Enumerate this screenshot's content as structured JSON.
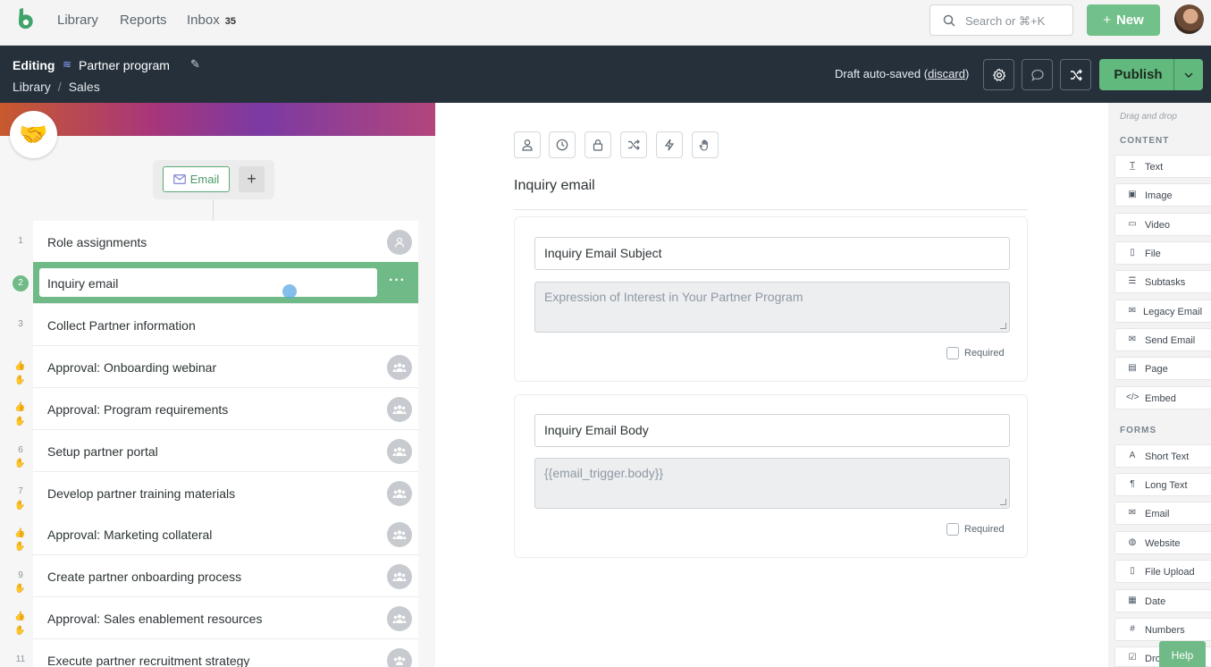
{
  "nav": {
    "links": [
      "Library",
      "Reports",
      "Inbox"
    ],
    "inbox_count": "35",
    "search_placeholder": "Search or ⌘+K",
    "new_label": "New"
  },
  "editbar": {
    "mode": "Editing",
    "title": "Partner program",
    "breadcrumb": [
      "Library",
      "Sales"
    ],
    "draft_text": "Draft auto-saved",
    "discard_label": "discard",
    "publish_label": "Publish"
  },
  "trigger": {
    "label": "Email"
  },
  "tasks": [
    {
      "num": "1",
      "label": "Role assignments"
    },
    {
      "num": "2",
      "label": "Inquiry email"
    },
    {
      "num": "3",
      "label": "Collect Partner information"
    },
    {
      "num": "",
      "label": "Approval: Onboarding webinar"
    },
    {
      "num": "",
      "label": "Approval: Program requirements"
    },
    {
      "num": "6",
      "label": "Setup partner portal"
    },
    {
      "num": "7",
      "label": "Develop partner training materials"
    },
    {
      "num": "",
      "label": "Approval: Marketing collateral"
    },
    {
      "num": "9",
      "label": "Create partner onboarding process"
    },
    {
      "num": "",
      "label": "Approval: Sales enablement resources"
    },
    {
      "num": "11",
      "label": "Execute partner recruitment strategy"
    }
  ],
  "editor": {
    "title": "Inquiry email",
    "fields": [
      {
        "label": "Inquiry Email Subject",
        "value": "Expression of Interest in Your Partner Program",
        "required_label": "Required"
      },
      {
        "label": "Inquiry Email Body",
        "value": "{{email_trigger.body}}",
        "required_label": "Required"
      }
    ]
  },
  "palette": {
    "hint": "Drag and drop",
    "content_title": "CONTENT",
    "content_items": [
      "Text",
      "Image",
      "Video",
      "File",
      "Subtasks",
      "Legacy Email",
      "Send Email",
      "Page",
      "Embed"
    ],
    "forms_title": "FORMS",
    "form_items": [
      "Short Text",
      "Long Text",
      "Email",
      "Website",
      "File Upload",
      "Date",
      "Numbers",
      "Dro"
    ]
  },
  "help_label": "Help"
}
